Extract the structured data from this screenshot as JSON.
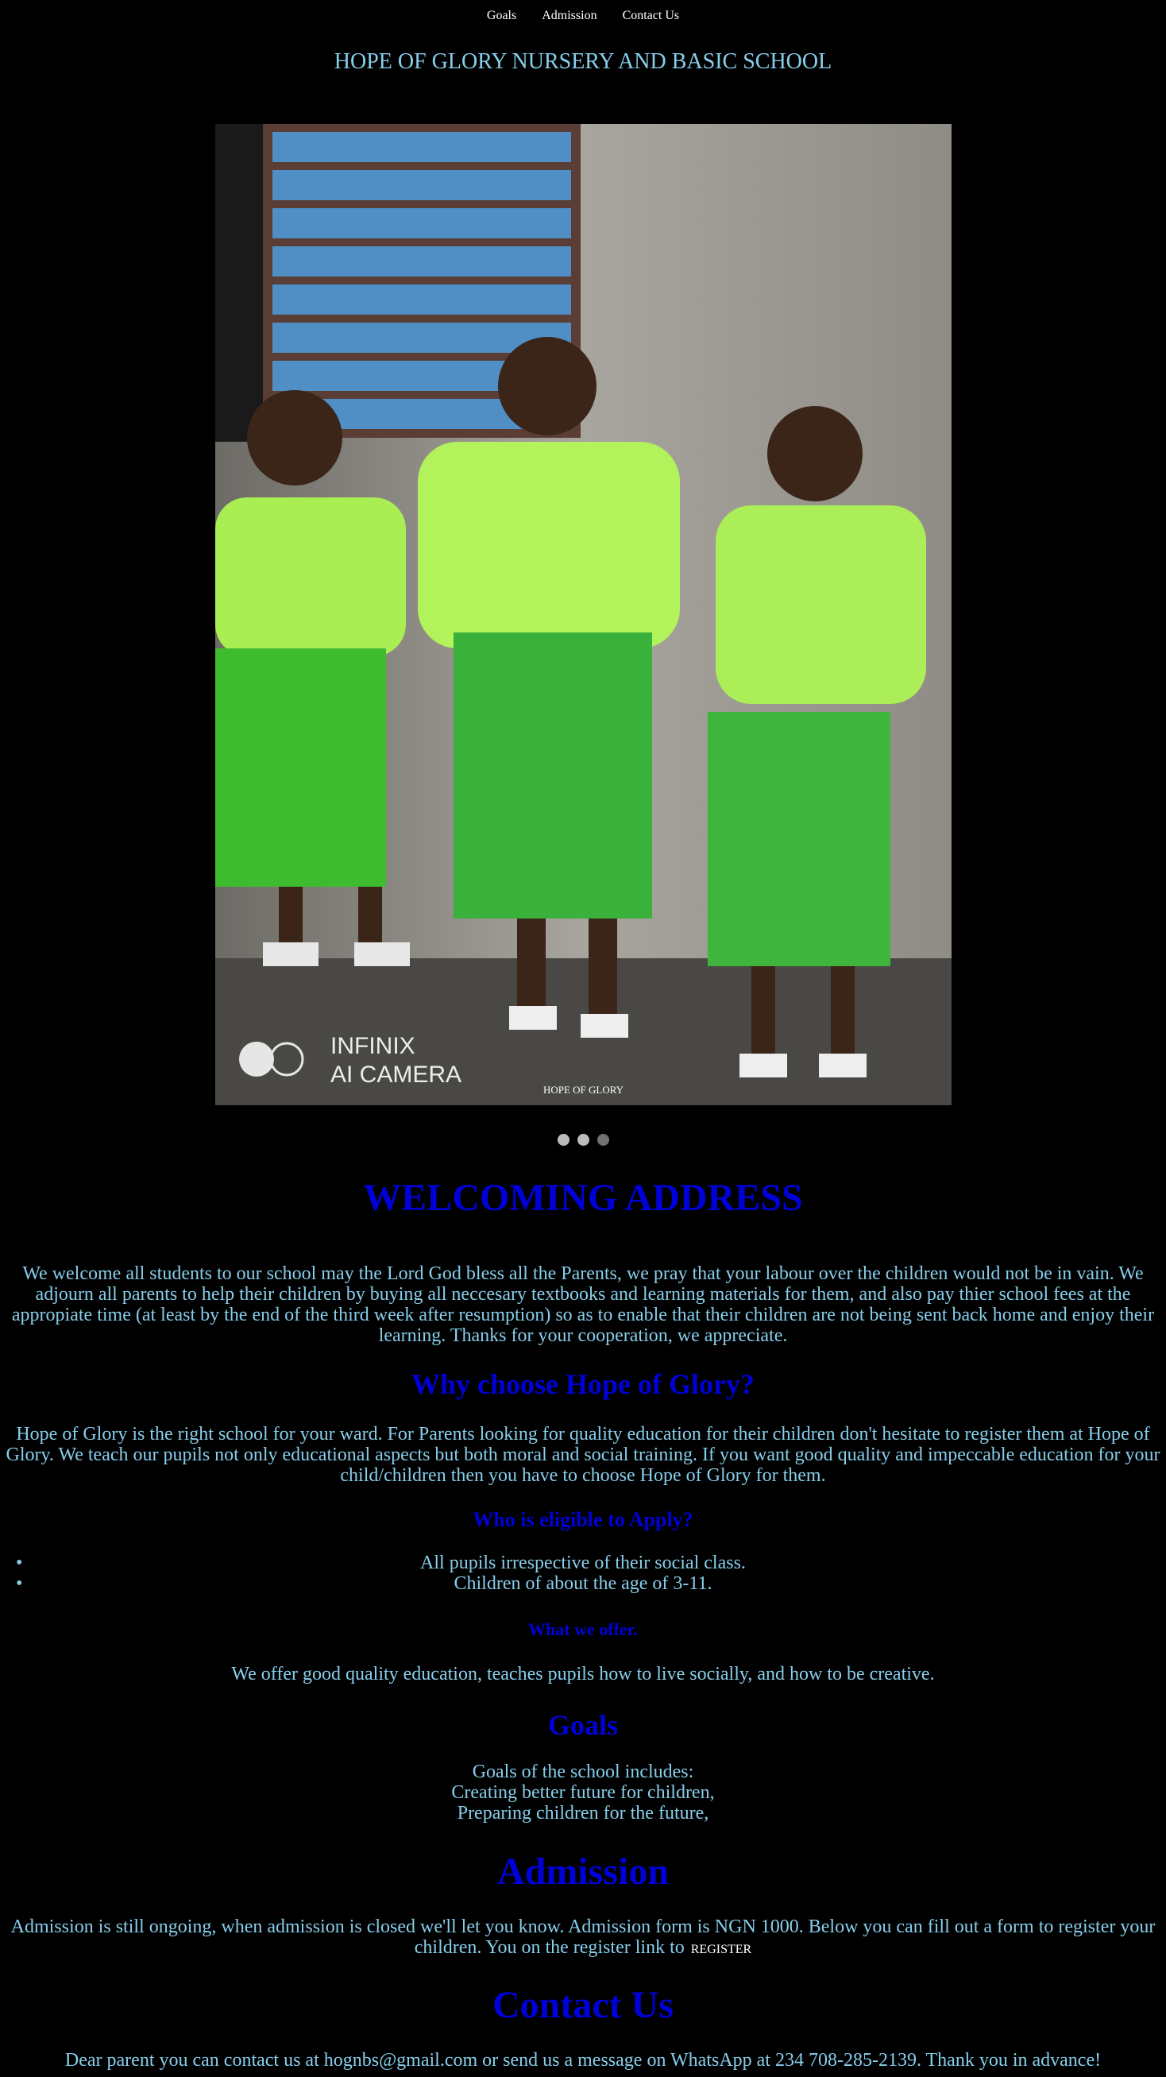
{
  "nav": {
    "items": [
      "Goals",
      "Admission",
      "Contact Us"
    ]
  },
  "site_title": "HOPE OF GLORY NURSERY AND BASIC SCHOOL",
  "slideshow": {
    "caption": "HOPE OF GLORY",
    "watermark_line1": "INFINIX",
    "watermark_line2": "AI CAMERA",
    "dots": [
      {
        "state": "active"
      },
      {
        "state": "active"
      },
      {
        "state": "inactive"
      }
    ]
  },
  "welcome": {
    "heading": "WELCOMING ADDRESS",
    "text": "We welcome all students to our school may the Lord God bless all the Parents, we pray that your labour over the children would not be in vain. We adjourn all parents to help their children by buying all neccesary textbooks and learning materials for them, and also pay thier school fees at the appropiate time (at least by the end of the third week after resumption) so as to enable that their children are not being sent back home and enjoy their learning. Thanks for your cooperation, we appreciate."
  },
  "why": {
    "heading": "Why choose Hope of Glory?",
    "text": "Hope of Glory is the right school for your ward. For Parents looking for quality education for their children don't hesitate to register them at Hope of Glory. We teach our pupils not only educational aspects but both moral and social training. If you want good quality and impeccable education for your child/children then you have to choose Hope of Glory for them."
  },
  "eligible": {
    "heading": "Who is eligible to Apply?",
    "items": [
      "All pupils irrespective of their social class.",
      "Children of about the age of 3-11."
    ]
  },
  "offer": {
    "heading": "What we offer.",
    "text": "We offer good quality education, teaches pupils how to live socially, and how to be creative."
  },
  "goals": {
    "heading": "Goals",
    "lines": [
      "Goals of the school includes:",
      "Creating better future for children,",
      "Preparing children for the future,"
    ]
  },
  "admission": {
    "heading": "Admission",
    "text": "Admission is still ongoing, when admission is closed we'll let you know. Admission form is NGN 1000. Below you can fill out a form to register your children. You on the register link to",
    "link_label": "REGISTER"
  },
  "contact": {
    "heading": "Contact Us",
    "text": "Dear parent you can contact us at hognbs@gmail.com or send us a message on WhatsApp at 234 708-285-2139. Thank you in advance!"
  },
  "colors": {
    "background": "#000000",
    "body_text": "#87ceeb",
    "heading": "#0000d8",
    "nav_text": "#ffffff"
  }
}
